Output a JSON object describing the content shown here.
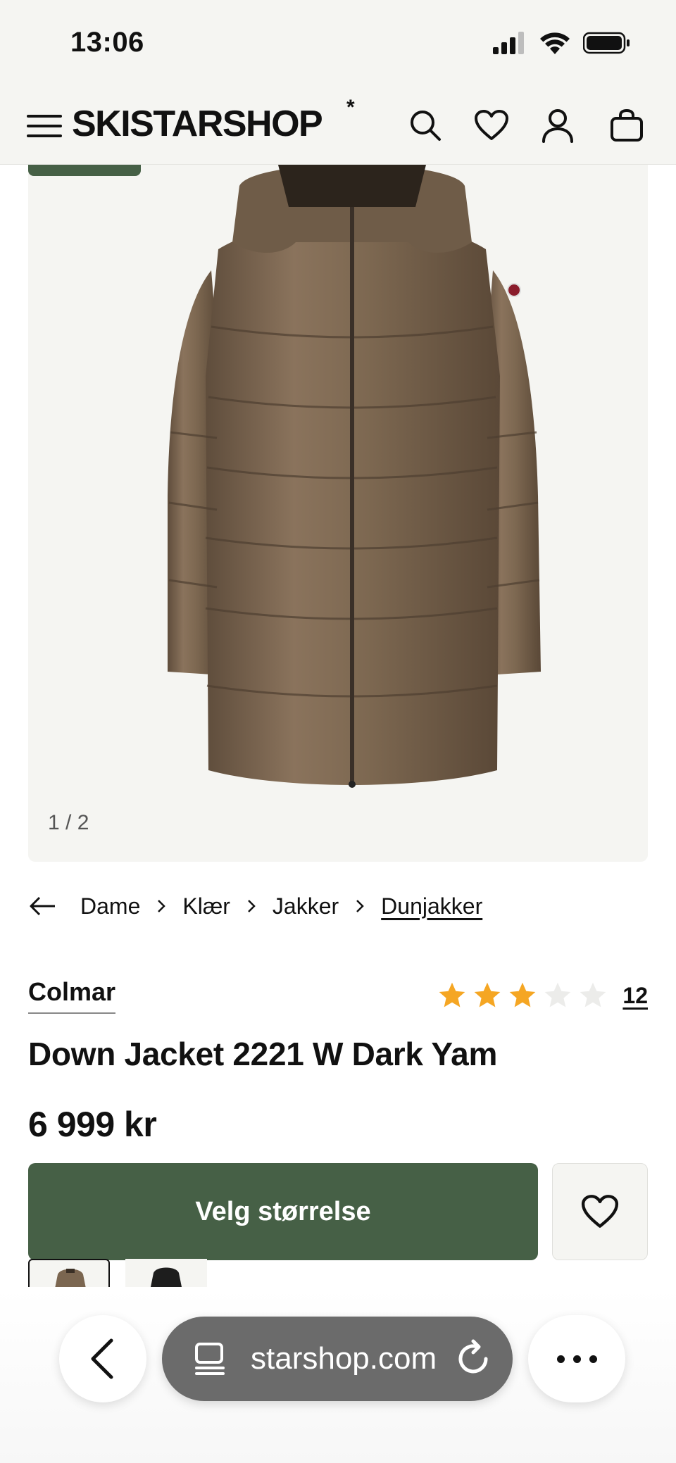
{
  "status": {
    "time": "13:06"
  },
  "header": {
    "logo": "SKISTARSHOP",
    "logo_mark": "*",
    "icons": [
      "menu-icon",
      "search-icon",
      "heart-icon",
      "user-icon",
      "bag-icon"
    ]
  },
  "gallery": {
    "counter": "1 / 2"
  },
  "breadcrumb": {
    "items": [
      "Dame",
      "Klær",
      "Jakker",
      "Dunjakker"
    ]
  },
  "product": {
    "brand": "Colmar",
    "name": "Down Jacket 2221 W Dark Yam",
    "price": "6 999 kr",
    "rating": 3,
    "rating_max": 5,
    "review_count": "12",
    "select_size_label": "Velg størrelse"
  },
  "browser": {
    "url": "starshop.com"
  },
  "colors": {
    "accent_green": "#466046",
    "star_filled": "#f5a623",
    "star_empty": "#ececea",
    "jacket_brown": "#7b6650"
  }
}
